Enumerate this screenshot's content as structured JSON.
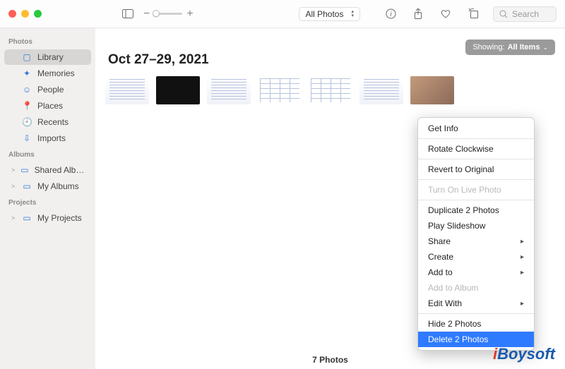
{
  "toolbar": {
    "filter_label": "All Photos",
    "search_placeholder": "Search"
  },
  "showing": {
    "prefix": "Showing:",
    "value": "All Items"
  },
  "sidebar": {
    "sections": [
      {
        "title": "Photos",
        "items": [
          {
            "icon": "▢",
            "label": "Library",
            "selected": true
          },
          {
            "icon": "✦",
            "label": "Memories"
          },
          {
            "icon": "☺",
            "label": "People"
          },
          {
            "icon": "📍",
            "label": "Places"
          },
          {
            "icon": "🕘",
            "label": "Recents"
          },
          {
            "icon": "⇩",
            "label": "Imports"
          }
        ]
      },
      {
        "title": "Albums",
        "items": [
          {
            "disc": ">",
            "icon": "▭",
            "label": "Shared Alb…"
          },
          {
            "disc": ">",
            "icon": "▭",
            "label": "My Albums"
          }
        ]
      },
      {
        "title": "Projects",
        "items": [
          {
            "disc": ">",
            "icon": "▭",
            "label": "My Projects"
          }
        ]
      }
    ]
  },
  "date_header": "Oct 27–29, 2021",
  "footer_count": "7 Photos",
  "thumbs": [
    {
      "cls": "doc",
      "selected": true
    },
    {
      "cls": "dark"
    },
    {
      "cls": "doc"
    },
    {
      "cls": "tbl"
    },
    {
      "cls": "tbl",
      "selected": true
    },
    {
      "cls": "doc"
    },
    {
      "cls": "photo"
    }
  ],
  "context_menu": [
    {
      "label": "Get Info"
    },
    {
      "sep": true
    },
    {
      "label": "Rotate Clockwise"
    },
    {
      "sep": true
    },
    {
      "label": "Revert to Original"
    },
    {
      "sep": true
    },
    {
      "label": "Turn On Live Photo",
      "disabled": true
    },
    {
      "sep": true
    },
    {
      "label": "Duplicate 2 Photos"
    },
    {
      "label": "Play Slideshow"
    },
    {
      "label": "Share",
      "submenu": true
    },
    {
      "label": "Create",
      "submenu": true
    },
    {
      "label": "Add to",
      "submenu": true
    },
    {
      "label": "Add to Album",
      "disabled": true
    },
    {
      "label": "Edit With",
      "submenu": true
    },
    {
      "sep": true
    },
    {
      "label": "Hide 2 Photos"
    },
    {
      "label": "Delete 2 Photos",
      "highlight": true
    }
  ],
  "watermark": {
    "i": "i",
    "rest": "Boysoft"
  }
}
